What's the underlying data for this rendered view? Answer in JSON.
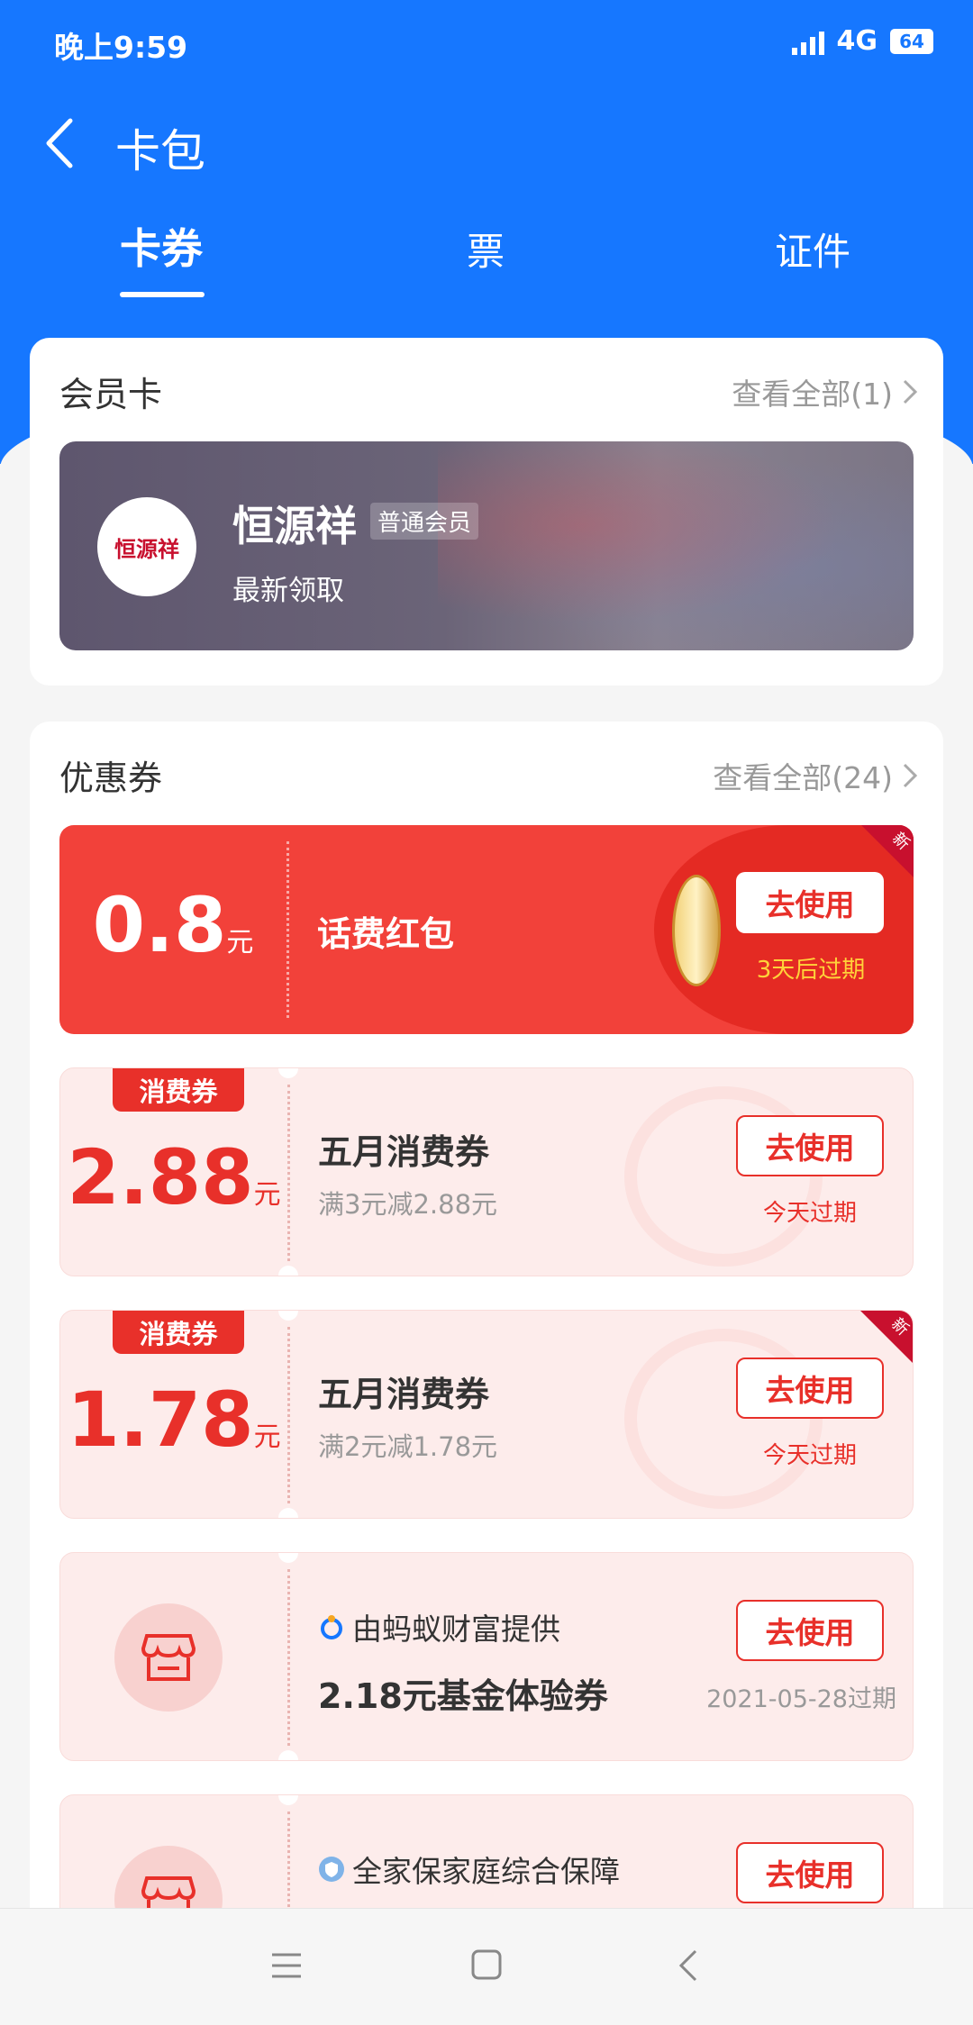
{
  "status": {
    "time": "晚上9:59",
    "network": "4G",
    "battery": "64"
  },
  "nav": {
    "title": "卡包"
  },
  "tabs": [
    {
      "label": "卡券"
    },
    {
      "label": "票"
    },
    {
      "label": "证件"
    }
  ],
  "member": {
    "section_title": "会员卡",
    "see_all": "查看全部(1)",
    "logo_text": "恒源祥",
    "brand": "恒源祥",
    "level": "普通会员",
    "subtitle": "最新领取"
  },
  "coupons_section": {
    "title": "优惠券",
    "see_all": "查看全部(24)"
  },
  "coupons": [
    {
      "amount": "0.8",
      "unit": "元",
      "title": "话费红包",
      "button": "去使用",
      "expire": "3天后过期",
      "new_badge": "新"
    },
    {
      "tag": "消费券",
      "amount": "2.88",
      "unit": "元",
      "title": "五月消费券",
      "desc": "满3元减2.88元",
      "button": "去使用",
      "expire": "今天过期"
    },
    {
      "tag": "消费券",
      "amount": "1.78",
      "unit": "元",
      "title": "五月消费券",
      "desc": "满2元减1.78元",
      "button": "去使用",
      "expire": "今天过期",
      "new_badge": "新"
    },
    {
      "provider": "由蚂蚁财富提供",
      "title": "2.18元基金体验券",
      "button": "去使用",
      "expire": "2021-05-28过期"
    },
    {
      "provider": "全家保家庭综合保障",
      "button": "去使用"
    }
  ],
  "colors": {
    "primary": "#1677ff",
    "coupon_red": "#f2413a",
    "accent_red": "#e8302a",
    "pink_bg": "#fdeceb"
  }
}
